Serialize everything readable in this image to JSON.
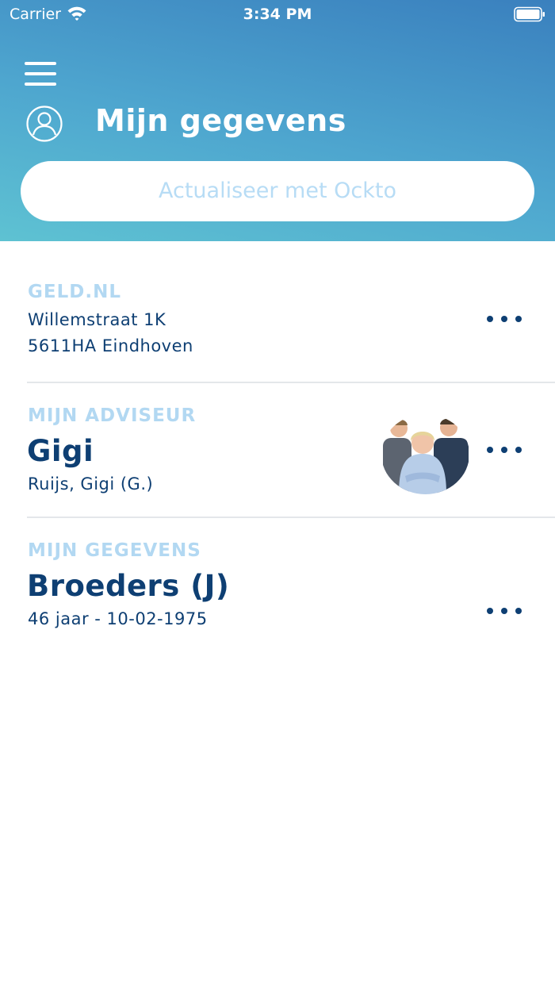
{
  "status_bar": {
    "carrier": "Carrier",
    "time": "3:34 PM"
  },
  "header": {
    "title": "Mijn gegevens",
    "ockto_button": "Actualiseer met Ockto"
  },
  "sections": {
    "office": {
      "label": "GELD.NL",
      "street": "Willemstraat 1K",
      "city": "5611HA Eindhoven"
    },
    "advisor": {
      "label": "MIJN ADVISEUR",
      "name": "Gigi",
      "full_name": "Ruijs, Gigi (G.)"
    },
    "personal": {
      "label": "MIJN GEGEVENS",
      "name": "Broeders (J)",
      "details": "46 jaar - 10-02-1975"
    }
  },
  "icons": {
    "menu": "hamburger-menu-icon",
    "profile": "user-circle-icon",
    "more": "more-horizontal-icon",
    "wifi": "wifi-icon",
    "battery": "battery-icon"
  },
  "colors": {
    "header_gradient_start": "#5ec2d2",
    "header_gradient_end": "#3a80be",
    "primary_text": "#0e3f73",
    "label_text": "#b2d8f2",
    "button_text": "#b7dcf5"
  }
}
